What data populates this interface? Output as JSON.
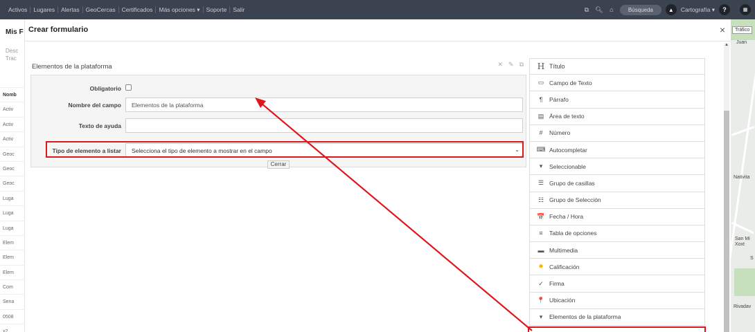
{
  "topnav": {
    "items": [
      "Activos",
      "Lugares",
      "Alertas",
      "GeoCercas",
      "Certificados",
      "Más opciones ▾",
      "Soporte",
      "Salir"
    ],
    "search_label": "Búsqueda",
    "cartography_label": "Cartografía ▾",
    "help_label": "?"
  },
  "background_page": {
    "title": "Mis F",
    "desc_1": "Desc",
    "desc_2": "Trac",
    "rows": [
      "Nomb",
      "Activ",
      "Activ",
      "Activ",
      "Geoc",
      "Geoc",
      "Geoc",
      "Luga",
      "Luga",
      "Luga",
      "Elem",
      "Elem",
      "Elem",
      "Com",
      "Sena",
      "0508",
      "x2"
    ]
  },
  "map": {
    "traffic_label": "Tráfico",
    "labels": [
      "Juan",
      "Nativita",
      "San Mi Xoxt",
      "S",
      "Rivadav"
    ]
  },
  "modal": {
    "title": "Crear formulario",
    "close": "×"
  },
  "preview": {
    "title": "Elementos de la plataforma",
    "fields": {
      "required_label": "Obligatorio",
      "name_label": "Nombre del campo",
      "name_value": "Elementos de la plataforma",
      "help_label": "Texto de ayuda",
      "help_value": "",
      "type_label": "Tipo de elemento a listar",
      "type_value": "Selecciona el tipo de elemento a mostrar en el campo"
    },
    "close_button": "Cerrar"
  },
  "palette": {
    "items": [
      {
        "label": "Título",
        "icon": "H",
        "name": "heading-icon"
      },
      {
        "label": "Campo de Texto",
        "icon": "▭",
        "name": "text-field-icon"
      },
      {
        "label": "Párrafo",
        "icon": "¶",
        "name": "paragraph-icon"
      },
      {
        "label": "Área de texto",
        "icon": "▤",
        "name": "textarea-icon"
      },
      {
        "label": "Número",
        "icon": "#",
        "name": "number-icon"
      },
      {
        "label": "Autocompletar",
        "icon": "⌨",
        "name": "autocomplete-icon"
      },
      {
        "label": "Seleccionable",
        "icon": "▾",
        "name": "select-icon"
      },
      {
        "label": "Grupo de casillas",
        "icon": "☰",
        "name": "checkbox-group-icon"
      },
      {
        "label": "Grupo de Selección",
        "icon": "☷",
        "name": "radio-group-icon"
      },
      {
        "label": "Fecha / Hora",
        "icon": "📅",
        "name": "calendar-icon"
      },
      {
        "label": "Tabla de opciones",
        "icon": "≡",
        "name": "table-options-icon"
      },
      {
        "label": "Multimedia",
        "icon": "▬",
        "name": "multimedia-icon"
      },
      {
        "label": "Calificación",
        "icon": "✸",
        "name": "rating-icon"
      },
      {
        "label": "Firma",
        "icon": "✓",
        "name": "signature-icon"
      },
      {
        "label": "Ubicación",
        "icon": "📍",
        "name": "location-pin-icon"
      },
      {
        "label": "Elementos de la plataforma",
        "icon": "▾",
        "name": "platform-elements-icon"
      }
    ]
  },
  "colors": {
    "topbar": "#3c4350",
    "highlight": "#e0161d"
  }
}
